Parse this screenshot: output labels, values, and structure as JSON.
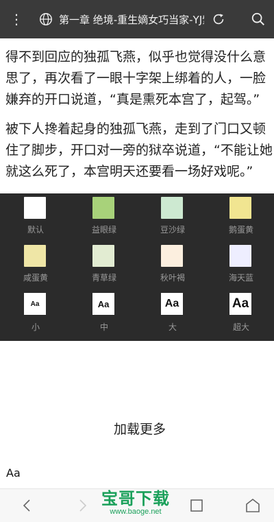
{
  "topbar": {
    "title": "第一章 绝境-重生嫡女巧当家-YJ紫鳶"
  },
  "article": {
    "paragraphs": [
      "得不到回应的独孤飞燕，似乎也觉得没什么意思了，再次看了一眼十字架上绑着的人，一脸嫌弃的开口说道，“真是熏死本宫了，起驾。”",
      "被下人搀着起身的独孤飞燕，走到了门口又顿住了脚步，开口对一旁的狱卒说道，“不能让她就这么死了，本宫明天还要看一场好戏呢。”"
    ]
  },
  "themes": [
    {
      "label": "默认",
      "color": "#ffffff"
    },
    {
      "label": "益眼绿",
      "color": "#a8d27a"
    },
    {
      "label": "豆沙绿",
      "color": "#cde9d1"
    },
    {
      "label": "鹅蛋黄",
      "color": "#f1e591"
    },
    {
      "label": "咸蛋黄",
      "color": "#efe6a6"
    },
    {
      "label": "青草绿",
      "color": "#e2ecd2"
    },
    {
      "label": "秋叶褐",
      "color": "#fcefdf"
    },
    {
      "label": "海天蓝",
      "color": "#eeeeff"
    }
  ],
  "font_sizes": [
    {
      "label": "小",
      "sample": "Aa"
    },
    {
      "label": "中",
      "sample": "Aa"
    },
    {
      "label": "大",
      "sample": "Aa"
    },
    {
      "label": "超大",
      "sample": "Aa"
    }
  ],
  "load_more": "加载更多",
  "aa_text": "Aa",
  "watermark": {
    "main": "宝哥下载",
    "sub": "www.baoge.net"
  },
  "icons": {
    "menu": "menu-dots-icon",
    "globe": "globe-icon",
    "refresh": "refresh-icon",
    "search": "search-icon",
    "back": "chevron-left-icon",
    "forward": "chevron-right-icon",
    "tabs": "tabs-square-icon",
    "home": "home-icon"
  }
}
